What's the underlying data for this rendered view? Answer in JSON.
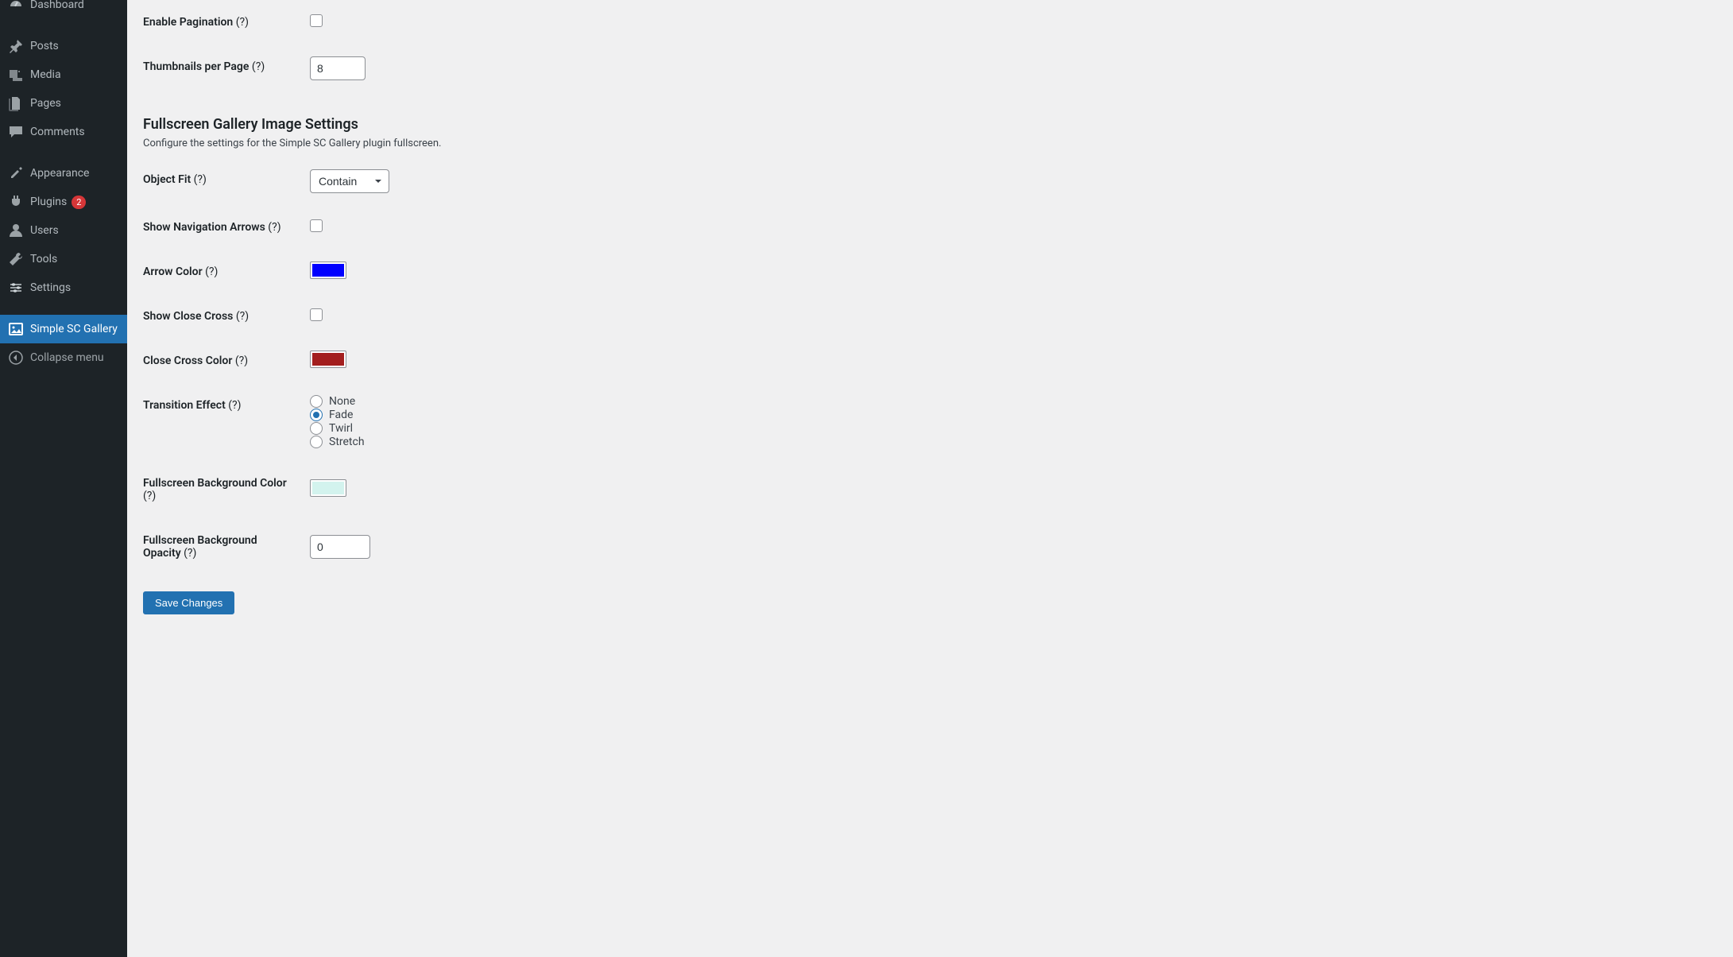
{
  "sidebar": {
    "items": [
      {
        "icon": "dashboard",
        "label": "Dashboard"
      },
      {
        "icon": "pin",
        "label": "Posts"
      },
      {
        "icon": "media",
        "label": "Media"
      },
      {
        "icon": "pages",
        "label": "Pages"
      },
      {
        "icon": "comments",
        "label": "Comments"
      },
      {
        "icon": "appearance",
        "label": "Appearance"
      },
      {
        "icon": "plugins",
        "label": "Plugins",
        "badge": "2"
      },
      {
        "icon": "users",
        "label": "Users"
      },
      {
        "icon": "tools",
        "label": "Tools"
      },
      {
        "icon": "settings",
        "label": "Settings"
      },
      {
        "icon": "gallery",
        "label": "Simple SC Gallery",
        "current": true
      },
      {
        "icon": "collapse",
        "label": "Collapse menu"
      }
    ]
  },
  "settings": {
    "enable_pagination": {
      "label": "Enable Pagination",
      "help": "(?)",
      "value": false
    },
    "thumbs_per_page": {
      "label": "Thumbnails per Page",
      "help": "(?)",
      "value": "8"
    },
    "section": {
      "title": "Fullscreen Gallery Image Settings",
      "desc": "Configure the settings for the Simple SC Gallery plugin fullscreen."
    },
    "object_fit": {
      "label": "Object Fit",
      "help": "(?)",
      "value": "Contain"
    },
    "show_arrows": {
      "label": "Show Navigation Arrows",
      "help": "(?)",
      "value": false
    },
    "arrow_color": {
      "label": "Arrow Color",
      "help": "(?)",
      "value": "#0000ff"
    },
    "show_close": {
      "label": "Show Close Cross",
      "help": "(?)",
      "value": false
    },
    "close_color": {
      "label": "Close Cross Color",
      "help": "(?)",
      "value": "#a31e1e"
    },
    "transition": {
      "label": "Transition Effect",
      "help": "(?)",
      "options": [
        "None",
        "Fade",
        "Twirl",
        "Stretch"
      ],
      "value": "Fade"
    },
    "bg_color": {
      "label": "Fullscreen Background Color",
      "help": "(?)",
      "value": "#d3f3ee"
    },
    "bg_opacity": {
      "label": "Fullscreen Background Opacity",
      "help": "(?)",
      "value": "0"
    },
    "save_label": "Save Changes"
  }
}
